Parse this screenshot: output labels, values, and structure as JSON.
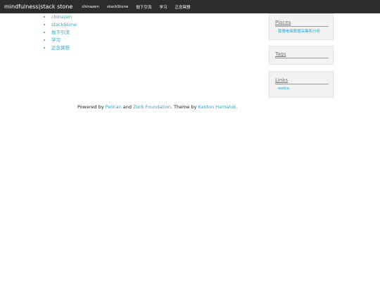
{
  "header": {
    "brand": "mindfulness|stack stone",
    "nav": [
      {
        "label": "chinazen"
      },
      {
        "label": "stackStone"
      },
      {
        "label": "抛下引流"
      },
      {
        "label": "学习"
      },
      {
        "label": "正念冥想"
      }
    ]
  },
  "main": {
    "list": [
      {
        "label": "chinazen"
      },
      {
        "label": "stackStone"
      },
      {
        "label": "抛下引流"
      },
      {
        "label": "学习"
      },
      {
        "label": "正念冥想"
      }
    ]
  },
  "sidebar": {
    "places": {
      "title": "Places",
      "items": [
        {
          "label": "- 我搜电商数据采集和分析"
        }
      ]
    },
    "tags": {
      "title": "Tags"
    },
    "links": {
      "title": "Links",
      "items": [
        {
          "label": "- weibo"
        }
      ]
    }
  },
  "footer": {
    "t1": "Powered by ",
    "pelican": "Pelican",
    "t2": " and ",
    "zurb": "Zurb Foundation",
    "t3": ". Theme by ",
    "kenton": "Kenton Hamaluk",
    "t4": "."
  },
  "colors": {
    "topbar_bg": "#2c2c2c",
    "link": "#2ba6cb",
    "widget_bg": "#f2f2f2"
  }
}
